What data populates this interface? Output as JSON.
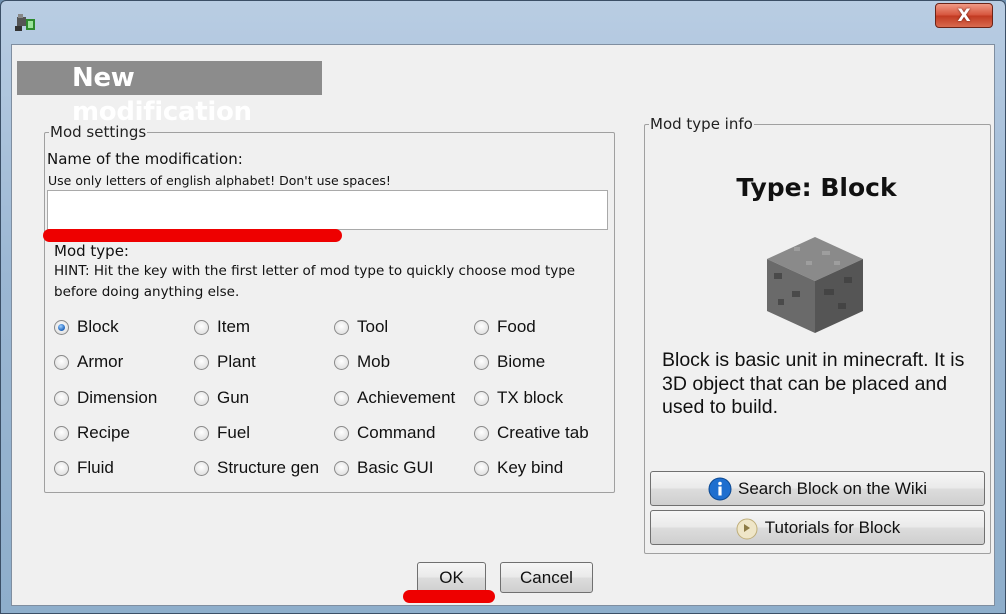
{
  "window": {
    "close_label": "X"
  },
  "header": {
    "title": "New modification"
  },
  "mod_settings": {
    "legend": "Mod settings",
    "name_label": "Name of the modification:",
    "name_hint": "Use only letters of english alphabet! Don't use spaces!",
    "name_value": "",
    "mod_type_label": "Mod type:",
    "hint_line1": "HINT: Hit the key with the first letter of mod type to quickly choose mod type",
    "hint_line2": "before doing anything else.",
    "selected": "Block",
    "options": [
      "Block",
      "Item",
      "Tool",
      "Food",
      "Armor",
      "Plant",
      "Mob",
      "Biome",
      "Dimension",
      "Gun",
      "Achievement",
      "TX block",
      "Recipe",
      "Fuel",
      "Command",
      "Creative tab",
      "Fluid",
      "Structure gen",
      "Basic GUI",
      "Key bind"
    ]
  },
  "mod_info": {
    "legend": "Mod type info",
    "type_title": "Type: Block",
    "description": "Block is basic unit in minecraft. It is 3D object that can be placed and used to build.",
    "wiki_button": "Search Block on the Wiki",
    "tutorials_button": "Tutorials for Block"
  },
  "footer": {
    "ok_label": "OK",
    "cancel_label": "Cancel"
  },
  "colors": {
    "annotation_red": "#ee0000",
    "header_bg": "#8c8c8c",
    "radio_selected": "#2a6fc4"
  }
}
